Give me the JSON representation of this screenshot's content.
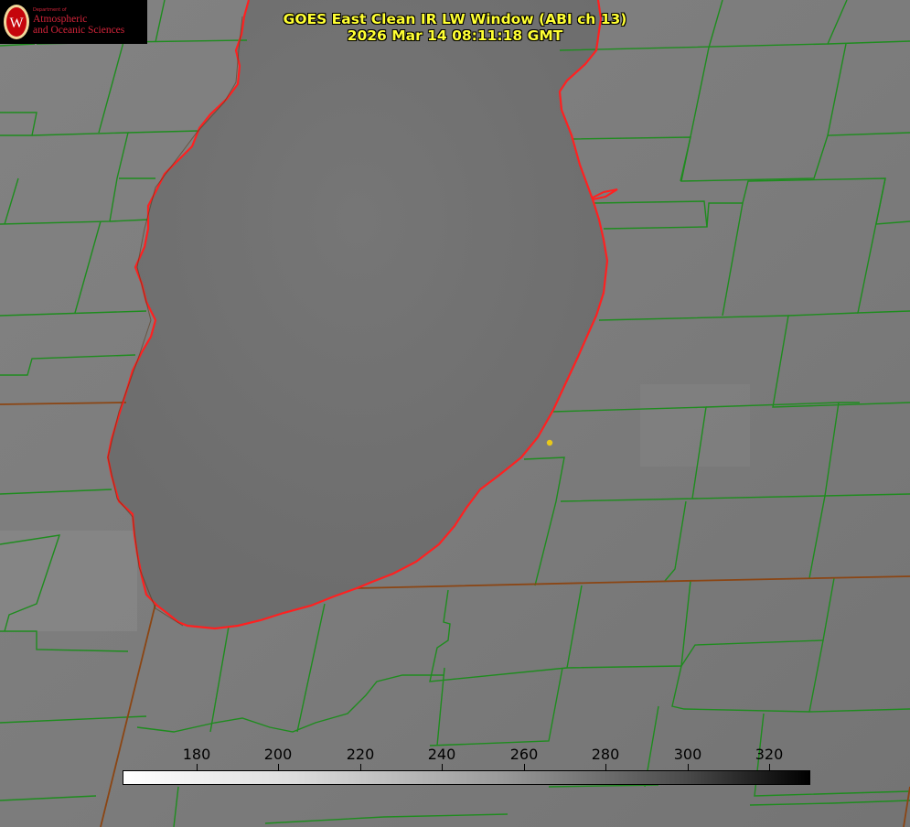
{
  "header": {
    "title_line1": "GOES East Clean IR LW Window (ABI ch 13)",
    "title_line2": "2026 Mar 14 08:11:18 GMT"
  },
  "logo": {
    "dept": "Department of",
    "line1": "Atmospheric",
    "line2": "and Oceanic Sciences",
    "seal_letter": "W"
  },
  "colorbar": {
    "ticks": [
      "180",
      "200",
      "220",
      "240",
      "260",
      "280",
      "300",
      "320"
    ],
    "gradient": "white-to-black"
  },
  "colors": {
    "title": "#ffff33",
    "coastline": "#ff2020",
    "county_lines": "#1e8c1e",
    "marker": "#e8c81a",
    "logo_text": "#d4243a"
  },
  "map": {
    "feature": "Lake Michigan (southern portion)",
    "marker": "yellow-dot"
  }
}
